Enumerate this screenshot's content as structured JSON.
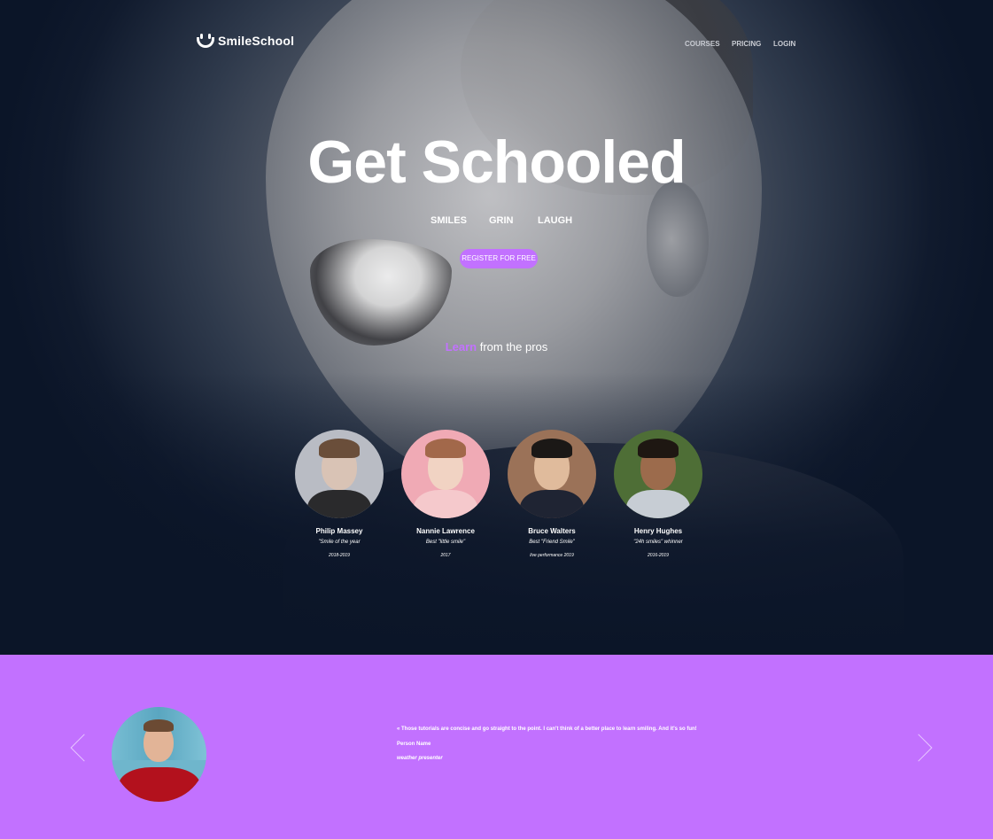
{
  "header": {
    "logo_text": "SmileSchool",
    "nav": [
      {
        "label": "COURSES"
      },
      {
        "label": "PRICING"
      },
      {
        "label": "LOGIN"
      }
    ]
  },
  "hero": {
    "title": "Get Schooled",
    "tags": [
      "SMILES",
      "GRIN",
      "LAUGH"
    ],
    "cta_label": "REGISTER FOR FREE"
  },
  "learn": {
    "accent": "Learn",
    "rest": " from the pros"
  },
  "pros": [
    {
      "name": "Philip Massey",
      "award": "\"Smile of the year",
      "years": "2018-2019",
      "skin": "#d9c3b5",
      "hair": "#6a4e3a",
      "shirt": "#2a2a2c",
      "bg": "#b9bcc4"
    },
    {
      "name": "Nannie Lawrence",
      "award": "Best \"little smile\"",
      "years": "2017",
      "skin": "#f1d3c3",
      "hair": "#a2684a",
      "shirt": "#f5c9cc",
      "bg": "#f0aab5"
    },
    {
      "name": "Bruce Walters",
      "award": "Best \"Friend Smile\"",
      "years": "live performance 2019",
      "skin": "#e0bb9c",
      "hair": "#1b1816",
      "shirt": "#1f2433",
      "bg": "#9b7258"
    },
    {
      "name": "Henry Hughes",
      "award": "\"24h smiles\" whinner",
      "years": "2016-2019",
      "skin": "#9c6b4c",
      "hair": "#1e1712",
      "shirt": "#c7cdd4",
      "bg": "#4e6e36"
    }
  ],
  "testimonial": {
    "quote": "« Those tutorials are concise and go straight to the point. I can't think of a better place to learn smiling. And it's so fun!",
    "author": "Person Name",
    "role": "weather presenter"
  },
  "colors": {
    "accent": "#c271ff",
    "dark_bg": "#0b1528"
  }
}
